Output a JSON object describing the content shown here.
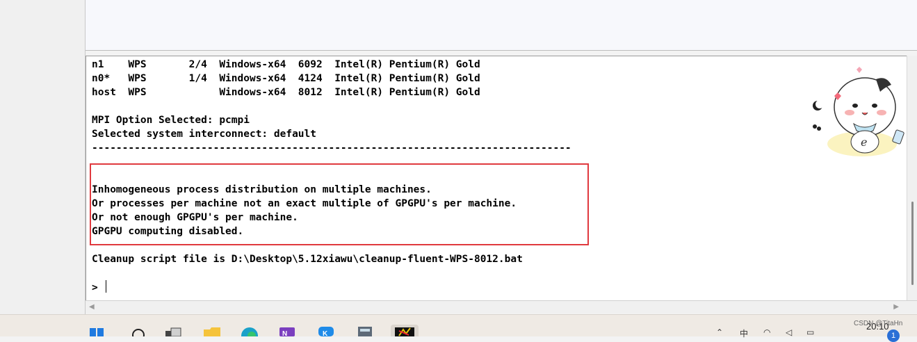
{
  "console": {
    "lines": [
      "n1    WPS       2/4  Windows-x64  6092  Intel(R) Pentium(R) Gold",
      "n0*   WPS       1/4  Windows-x64  4124  Intel(R) Pentium(R) Gold",
      "host  WPS            Windows-x64  8012  Intel(R) Pentium(R) Gold",
      "",
      "MPI Option Selected: pcmpi",
      "Selected system interconnect: default",
      "-------------------------------------------------------------------------------",
      "",
      "",
      "Inhomogeneous process distribution on multiple machines.",
      "Or processes per machine not an exact multiple of GPGPU's per machine.",
      "Or not enough GPGPU's per machine.",
      "GPGPU computing disabled.",
      "",
      "Cleanup script file is D:\\Desktop\\5.12xiawu\\cleanup-fluent-WPS-8012.bat",
      "",
      "> "
    ],
    "highlight_color": "#e0393e"
  },
  "scrollbars": {
    "horizontal_left_arrow": "◀",
    "horizontal_right_arrow": "▶"
  },
  "taskbar": {
    "icons": [
      "windows-start-icon",
      "search-icon",
      "task-view-icon",
      "file-explorer-icon",
      "edge-icon",
      "onenote-icon",
      "kugou-icon",
      "calculator-icon",
      "fluent-icon"
    ],
    "tray": {
      "clock": "20:10",
      "watermark": "CSDN @TitaHn",
      "notification_count": "1"
    }
  }
}
